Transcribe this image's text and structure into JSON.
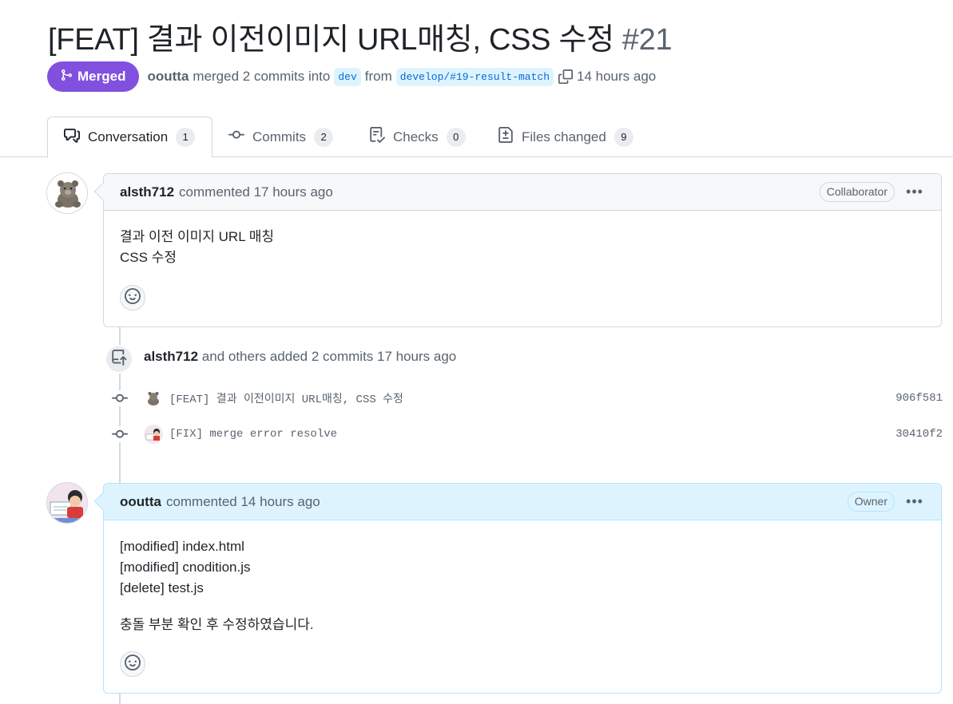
{
  "pr": {
    "title": "[FEAT] 결과 이전이미지 URL매칭, CSS 수정",
    "number": "#21",
    "state_label": "Merged",
    "author": "ooutta",
    "action_text": "merged 2 commits into",
    "base_branch": "dev",
    "from_text": "from",
    "head_branch": "develop/#19-result-match",
    "time": "14 hours ago"
  },
  "tabs": [
    {
      "label": "Conversation",
      "count": "1"
    },
    {
      "label": "Commits",
      "count": "2"
    },
    {
      "label": "Checks",
      "count": "0"
    },
    {
      "label": "Files changed",
      "count": "9"
    }
  ],
  "comment1": {
    "author": "alsth712",
    "meta": "commented 17 hours ago",
    "role": "Collaborator",
    "lines": [
      "결과 이전 이미지 URL 매칭",
      "CSS 수정"
    ]
  },
  "commits_event": {
    "author": "alsth712",
    "text": "and others added 2 commits 17 hours ago",
    "commits": [
      {
        "message": "[FEAT] 결과 이전이미지 URL매칭, CSS 수정",
        "sha": "906f581"
      },
      {
        "message": "[FIX] merge error resolve",
        "sha": "30410f2"
      }
    ]
  },
  "comment2": {
    "author": "ooutta",
    "meta": "commented 14 hours ago",
    "role": "Owner",
    "lines": [
      "[modified] index.html",
      "[modified] cnodition.js",
      "[delete] test.js"
    ],
    "note": "충돌 부분 확인 후 수정하였습니다."
  },
  "colors": {
    "merged": "#8250df",
    "branch_bg": "#ddf4ff",
    "branch_fg": "#0969da",
    "owner_header": "#ddf4ff"
  },
  "icons": [
    "merge-icon",
    "copy-icon",
    "conversation-icon",
    "commit-icon",
    "checks-icon",
    "file-diff-icon",
    "smiley-icon",
    "kebab-icon",
    "repo-push-icon"
  ]
}
